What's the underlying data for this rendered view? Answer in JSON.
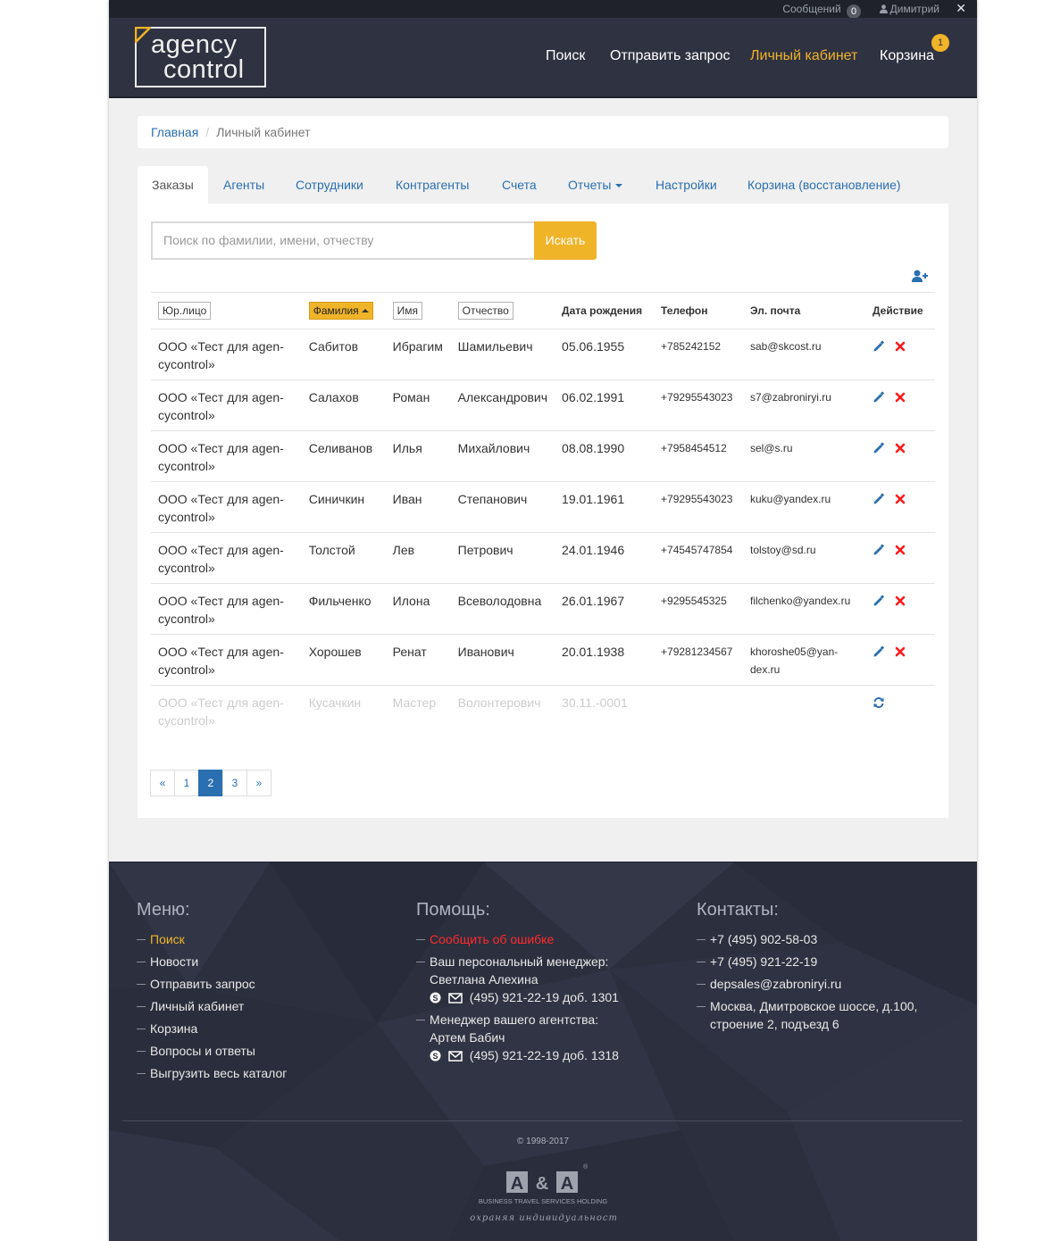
{
  "topbar": {
    "messages_label": "Сообщений",
    "messages_count": "0",
    "user_name": "Димитрий",
    "close_symbol": "✕"
  },
  "logo": {
    "line1": "agency",
    "line2": "control"
  },
  "nav": {
    "search": "Поиск",
    "send_request": "Отправить запрос",
    "cabinet": "Личный кабинет",
    "cart": "Корзина",
    "cart_count": "1"
  },
  "breadcrumb": {
    "home": "Главная",
    "current": "Личный кабинет"
  },
  "tabs": [
    "Заказы",
    "Агенты",
    "Сотрудники",
    "Контрагенты",
    "Счета",
    "Отчеты",
    "Настройки",
    "Корзина (восстановление)"
  ],
  "search": {
    "placeholder": "Поиск по фамилии, имени, отчеству",
    "button": "Искать"
  },
  "table": {
    "headers": [
      "Юр.лицо",
      "Фамилия",
      "Имя",
      "Отчество",
      "Дата рождения",
      "Телефон",
      "Эл. почта",
      "Действие"
    ],
    "rows": [
      {
        "company": "ООО «Тест для agen-cycontrol»",
        "last": "Сабитов",
        "first": "Ибрагим",
        "middle": "Шамильевич",
        "dob": "05.06.1955",
        "phone": "+785242152",
        "email": "sab@skcost.ru"
      },
      {
        "company": "ООО «Тест для agen-cycontrol»",
        "last": "Салахов",
        "first": "Роман",
        "middle": "Александрович",
        "dob": "06.02.1991",
        "phone": "+79295543023",
        "email": "s7@zabroniryi.ru"
      },
      {
        "company": "ООО «Тест для agen-cycontrol»",
        "last": "Селиванов",
        "first": "Илья",
        "middle": "Михайлович",
        "dob": "08.08.1990",
        "phone": "+7958454512",
        "email": "sel@s.ru"
      },
      {
        "company": "ООО «Тест для agen-cycontrol»",
        "last": "Синичкин",
        "first": "Иван",
        "middle": "Степанович",
        "dob": "19.01.1961",
        "phone": "+79295543023",
        "email": "kuku@yandex.ru"
      },
      {
        "company": "ООО «Тест для agen-cycontrol»",
        "last": "Толстой",
        "first": "Лев",
        "middle": "Петрович",
        "dob": "24.01.1946",
        "phone": "+74545747854",
        "email": "tolstoy@sd.ru"
      },
      {
        "company": "ООО «Тест для agen-cycontrol»",
        "last": "Фильченко",
        "first": "Илона",
        "middle": "Всеволодовна",
        "dob": "26.01.1967",
        "phone": "+9295545325",
        "email": "filchenko@yandex.ru"
      },
      {
        "company": "ООО «Тест для agen-cycontrol»",
        "last": "Хорошев",
        "first": "Ренат",
        "middle": "Иванович",
        "dob": "20.01.1938",
        "phone": "+79281234567",
        "email": "khoroshe05@yan-dex.ru"
      },
      {
        "company": "ООО «Тест для agen-cycontrol»",
        "last": "Кусачкин",
        "first": "Мастер",
        "middle": "Волонтерович",
        "dob": "30.11.-0001",
        "phone": "",
        "email": ""
      }
    ]
  },
  "pagination": {
    "prev": "«",
    "pages": [
      "1",
      "2",
      "3"
    ],
    "next": "»"
  },
  "footer": {
    "menu_title": "Меню:",
    "menu": [
      "Поиск",
      "Новости",
      "Отправить запрос",
      "Личный кабинет",
      "Корзина",
      "Вопросы и ответы",
      "Выгрузить весь каталог"
    ],
    "help_title": "Помощь:",
    "report_error": "Сообщить об ошибке",
    "manager1_title": "Ваш персональный менеджер:",
    "manager1_name": "Светлана Алехина",
    "manager1_phone": "(495) 921-22-19 доб. 1301",
    "manager2_title": "Менеджер вашего агентства:",
    "manager2_name": "Артем Бабич",
    "manager2_phone": "(495) 921-22-19 доб. 1318",
    "contacts_title": "Контакты:",
    "phone1": "+7 (495) 902-58-03",
    "phone2": "+7 (495) 921-22-19",
    "email": "depsales@zabroniryi.ru",
    "address": "Москва, Дмитровское шоссе, д.100, строение 2, подъезд 6",
    "copyright": "© 1998-2017",
    "aa_logo": "A&A",
    "aa_tagline": "BUSINESS TRAVEL SERVICES HOLDING",
    "aa_slogan": "Сохраняя индивидуальность"
  },
  "colors": {
    "accent": "#f0b429",
    "link": "#2a6fb0",
    "header_bg": "#2f3241",
    "footer_bg": "#2c2f3e",
    "danger": "#ff2b2b"
  }
}
